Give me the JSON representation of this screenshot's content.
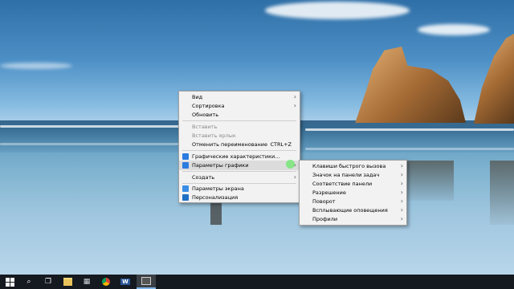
{
  "colors": {
    "menu_bg": "#f2f2f2",
    "highlight": "#dcdcdc",
    "taskbar": "#151a20",
    "accent": "#1e73d8"
  },
  "desktop_menu": {
    "items": [
      {
        "label": "Вид",
        "submenu": true
      },
      {
        "label": "Сортировка",
        "submenu": true
      },
      {
        "label": "Обновить"
      },
      {
        "label": "Вставить",
        "disabled": true
      },
      {
        "label": "Вставить ярлык",
        "disabled": true
      },
      {
        "label": "Отменить переименование",
        "shortcut": "CTRL+Z"
      },
      {
        "label": "Графические характеристики...",
        "icon": "intel-graphics-icon"
      },
      {
        "label": "Параметры графики",
        "icon": "intel-graphics-icon",
        "submenu": true,
        "highlighted": true
      },
      {
        "label": "Создать",
        "submenu": true
      },
      {
        "label": "Параметры экрана",
        "icon": "display-settings-icon"
      },
      {
        "label": "Персонализация",
        "icon": "personalize-icon"
      }
    ]
  },
  "graphics_submenu": {
    "items": [
      {
        "label": "Клавиши быстрого вызова"
      },
      {
        "label": "Значок на панели задач"
      },
      {
        "label": "Соответствие панели"
      },
      {
        "label": "Разрешение"
      },
      {
        "label": "Поворот"
      },
      {
        "label": "Всплывающие оповещения"
      },
      {
        "label": "Профили"
      }
    ]
  },
  "taskbar": {
    "items": [
      {
        "name": "start-button",
        "icon": "windows-logo-icon"
      },
      {
        "name": "search-button",
        "icon": "search-icon",
        "glyph": "⌕"
      },
      {
        "name": "task-view-button",
        "icon": "task-view-icon",
        "glyph": "❐"
      },
      {
        "name": "file-explorer-button",
        "icon": "folder-icon"
      },
      {
        "name": "calculator-button",
        "icon": "calculator-icon",
        "glyph": "▦"
      },
      {
        "name": "chrome-button",
        "icon": "chrome-icon"
      },
      {
        "name": "word-button",
        "icon": "word-icon",
        "glyph": "W"
      },
      {
        "name": "screen-recorder-button",
        "icon": "recorder-icon"
      }
    ]
  }
}
